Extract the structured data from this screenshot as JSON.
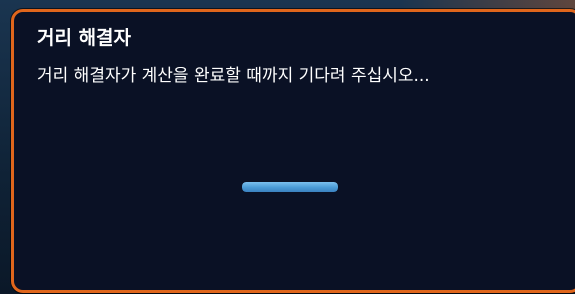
{
  "dialog": {
    "title": "거리 해결자",
    "message": "거리 해결자가 계산을 완료할 때까지 기다려 주십시오...",
    "progress_fraction": 1.0
  },
  "colors": {
    "dialog_background": "#0a1125",
    "dialog_border": "#e0661c",
    "progress": "#4a9bd6",
    "text": "#ffffff"
  }
}
